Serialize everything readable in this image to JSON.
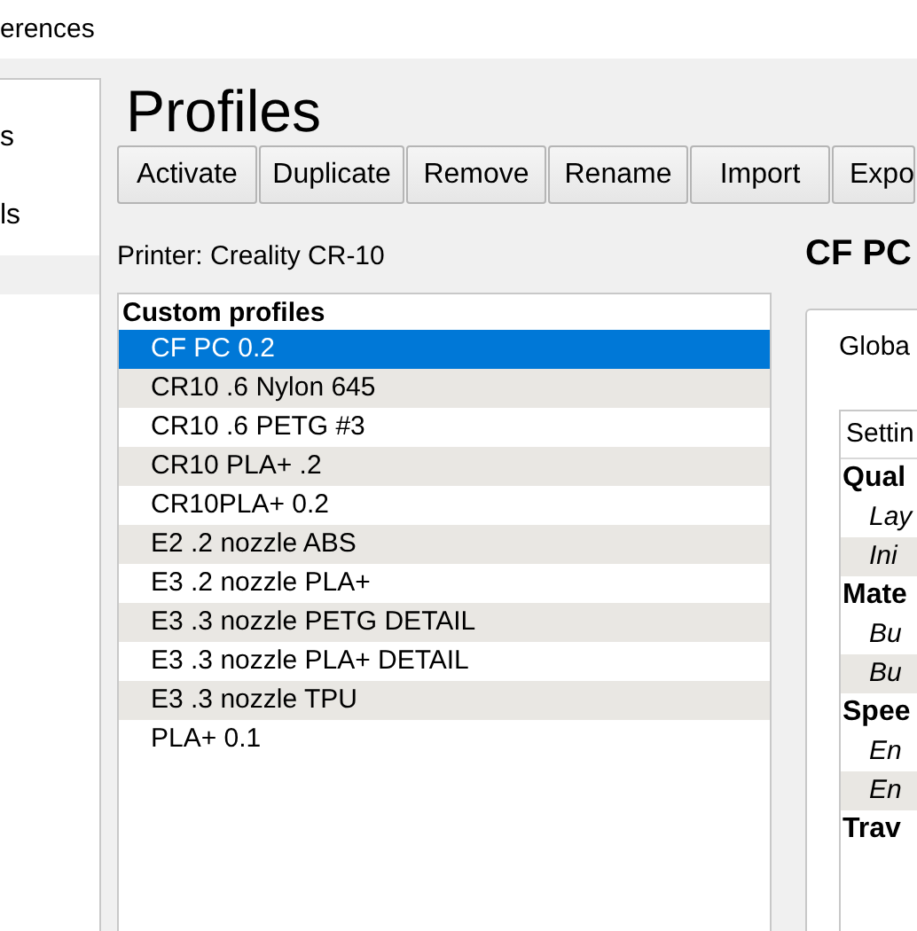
{
  "window": {
    "title": "erences"
  },
  "sidebar": {
    "items": [
      {
        "label": "s",
        "selected": false
      },
      {
        "label": "ls",
        "selected": false
      },
      {
        "selected": true
      }
    ]
  },
  "page": {
    "title": "Profiles"
  },
  "toolbar": {
    "buttons": [
      "Activate",
      "Duplicate",
      "Remove",
      "Rename",
      "Import",
      "Expo"
    ]
  },
  "printer": "Printer: Creality CR-10",
  "profiles": {
    "header": "Custom profiles",
    "items": [
      {
        "label": "CF PC 0.2",
        "selected": true
      },
      {
        "label": "CR10 .6 Nylon 645",
        "selected": false
      },
      {
        "label": "CR10 .6 PETG #3",
        "selected": false
      },
      {
        "label": "CR10 PLA+ .2",
        "selected": false
      },
      {
        "label": "CR10PLA+ 0.2",
        "selected": false
      },
      {
        "label": "E2 .2 nozzle ABS",
        "selected": false
      },
      {
        "label": "E3 .2 nozzle PLA+",
        "selected": false
      },
      {
        "label": "E3 .3 nozzle PETG DETAIL",
        "selected": false
      },
      {
        "label": "E3 .3 nozzle PLA+ DETAIL",
        "selected": false
      },
      {
        "label": "E3 .3 nozzle TPU",
        "selected": false
      },
      {
        "label": "PLA+ 0.1",
        "selected": false
      }
    ]
  },
  "detail": {
    "title": "CF PC",
    "tab": "Globa",
    "table": {
      "column": "Settin",
      "rows": [
        {
          "kind": "category",
          "label": "Qual"
        },
        {
          "kind": "setting",
          "label": "Lay"
        },
        {
          "kind": "setting",
          "label": "Ini"
        },
        {
          "kind": "category",
          "label": "Mate"
        },
        {
          "kind": "setting",
          "label": "Bu"
        },
        {
          "kind": "setting",
          "label": "Bu"
        },
        {
          "kind": "category",
          "label": "Spee"
        },
        {
          "kind": "setting",
          "label": "En"
        },
        {
          "kind": "setting",
          "label": "En"
        },
        {
          "kind": "category",
          "label": "Trav"
        }
      ]
    }
  }
}
